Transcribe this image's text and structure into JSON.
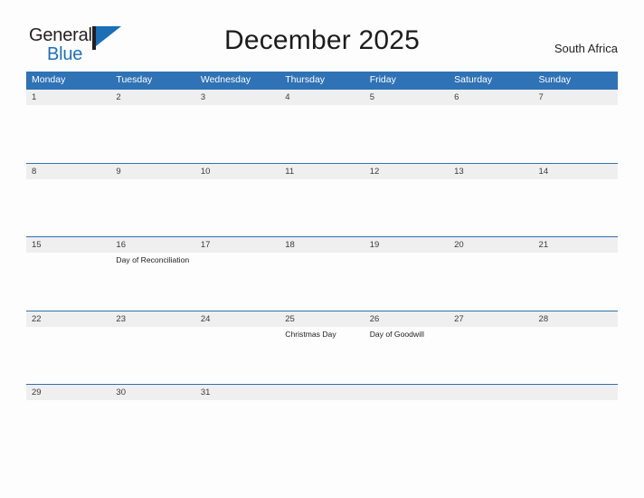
{
  "brand": {
    "name_part1": "General",
    "name_part2": "Blue",
    "flag_icon": "triangle-flag-icon",
    "accent_color": "#1b6fb5"
  },
  "header": {
    "title": "December 2025",
    "region": "South Africa"
  },
  "calendar": {
    "header_color": "#2f72b5",
    "band_color": "#efeff0",
    "rule_color": "#2f72b5",
    "weekdays": [
      "Monday",
      "Tuesday",
      "Wednesday",
      "Thursday",
      "Friday",
      "Saturday",
      "Sunday"
    ],
    "weeks": [
      {
        "days": [
          {
            "date": "1",
            "event": ""
          },
          {
            "date": "2",
            "event": ""
          },
          {
            "date": "3",
            "event": ""
          },
          {
            "date": "4",
            "event": ""
          },
          {
            "date": "5",
            "event": ""
          },
          {
            "date": "6",
            "event": ""
          },
          {
            "date": "7",
            "event": ""
          }
        ]
      },
      {
        "days": [
          {
            "date": "8",
            "event": ""
          },
          {
            "date": "9",
            "event": ""
          },
          {
            "date": "10",
            "event": ""
          },
          {
            "date": "11",
            "event": ""
          },
          {
            "date": "12",
            "event": ""
          },
          {
            "date": "13",
            "event": ""
          },
          {
            "date": "14",
            "event": ""
          }
        ]
      },
      {
        "days": [
          {
            "date": "15",
            "event": ""
          },
          {
            "date": "16",
            "event": "Day of Reconciliation"
          },
          {
            "date": "17",
            "event": ""
          },
          {
            "date": "18",
            "event": ""
          },
          {
            "date": "19",
            "event": ""
          },
          {
            "date": "20",
            "event": ""
          },
          {
            "date": "21",
            "event": ""
          }
        ]
      },
      {
        "days": [
          {
            "date": "22",
            "event": ""
          },
          {
            "date": "23",
            "event": ""
          },
          {
            "date": "24",
            "event": ""
          },
          {
            "date": "25",
            "event": "Christmas Day"
          },
          {
            "date": "26",
            "event": "Day of Goodwill"
          },
          {
            "date": "27",
            "event": ""
          },
          {
            "date": "28",
            "event": ""
          }
        ]
      },
      {
        "days": [
          {
            "date": "29",
            "event": ""
          },
          {
            "date": "30",
            "event": ""
          },
          {
            "date": "31",
            "event": ""
          },
          {
            "date": "",
            "event": ""
          },
          {
            "date": "",
            "event": ""
          },
          {
            "date": "",
            "event": ""
          },
          {
            "date": "",
            "event": ""
          }
        ]
      }
    ]
  }
}
